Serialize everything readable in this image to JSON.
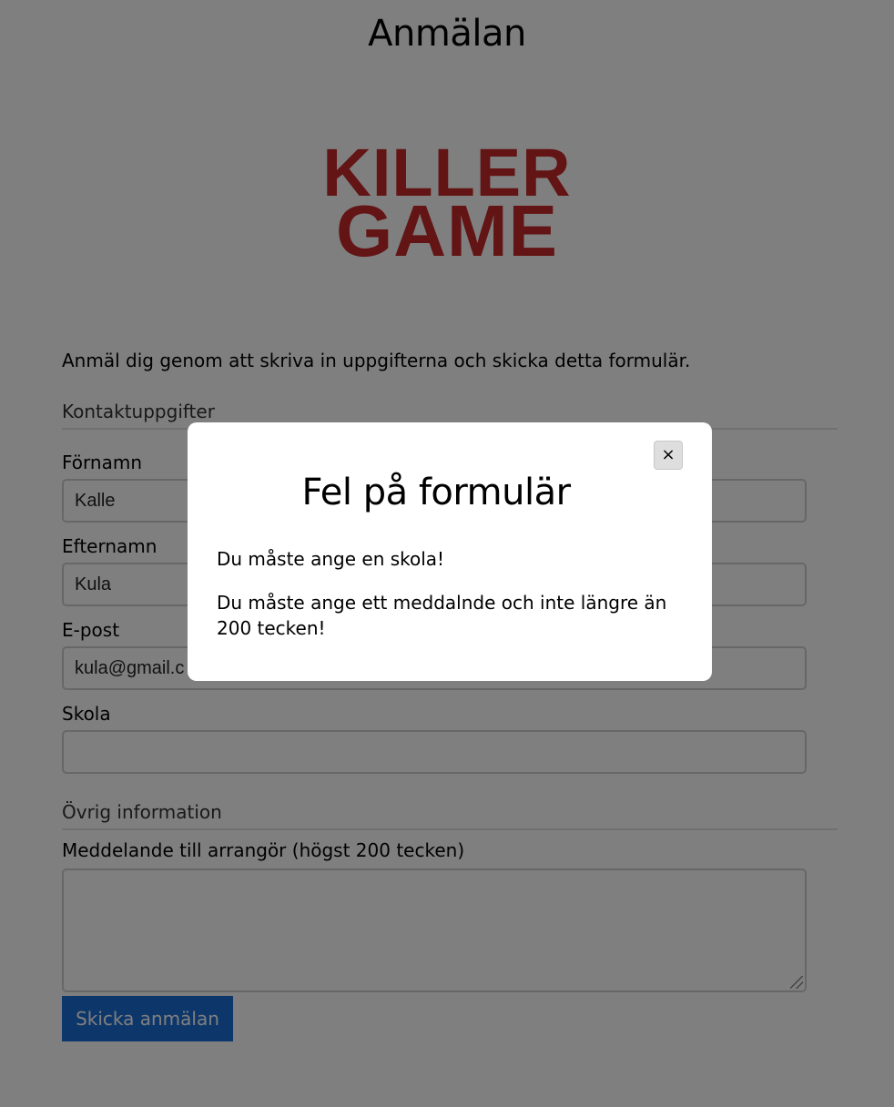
{
  "page": {
    "title": "Anmälan",
    "logo": {
      "line1": "KILLER",
      "line2": "GAME"
    },
    "intro": "Anmäl dig genom att skriva in uppgifterna och skicka detta formulär."
  },
  "contact": {
    "section_title": "Kontaktuppgifter",
    "firstname": {
      "label": "Förnamn",
      "value": "Kalle"
    },
    "lastname": {
      "label": "Efternamn",
      "value": "Kula"
    },
    "email": {
      "label": "E-post",
      "value": "kula@gmail.c"
    },
    "school": {
      "label": "Skola",
      "value": ""
    }
  },
  "other": {
    "section_title": "Övrig information",
    "message": {
      "label": "Meddelande till arrangör (högst 200 tecken)",
      "value": ""
    }
  },
  "submit_label": "Skicka anmälan",
  "modal": {
    "title": "Fel på formulär",
    "close_glyph": "×",
    "errors": [
      "Du måste ange en skola!",
      "Du måste ange ett meddalnde och inte längre än 200 tecken!"
    ]
  },
  "colors": {
    "logo_red": "#c62828",
    "button_blue": "#1b6fd6"
  }
}
